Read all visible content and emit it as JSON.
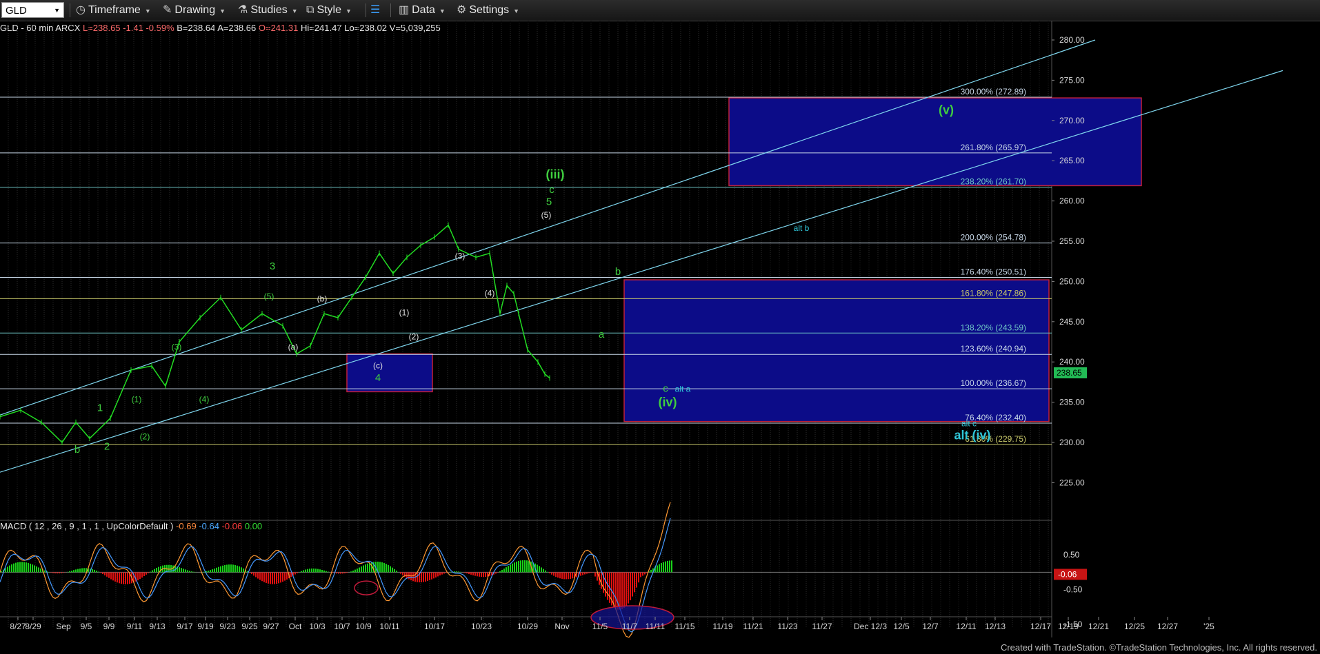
{
  "toolbar": {
    "symbol": "GLD",
    "timeframe": "Timeframe",
    "drawing": "Drawing",
    "studies": "Studies",
    "style": "Style",
    "data": "Data",
    "settings": "Settings"
  },
  "info": {
    "name": "GLD - 60 min  ARCX",
    "last": "L=238.65",
    "change": "-1.41",
    "pct": "-0.59%",
    "bid": "B=238.64",
    "ask": "A=238.66",
    "open": "O=241.31",
    "hi": "Hi=241.47",
    "lo": "Lo=238.02",
    "vol": "V=5,039,255"
  },
  "macd_header": {
    "label": "MACD ( 12 , 26 , 9 , 1 , 1 , UpColorDefault )",
    "v1": "-0.69",
    "v2": "-0.64",
    "v3": "-0.06",
    "v4": "0.00"
  },
  "footer": "Created with TradeStation. ©TradeStation Technologies, Inc. All rights reserved.",
  "colors": {
    "price": "#22dd22",
    "channel": "#7fd6ee",
    "box_fill": "#0c0c88",
    "box_border": "#c0203a",
    "wave_green": "#3fcf3f",
    "wave_white": "#e0e0e0",
    "wave_cyan": "#2fc6d8"
  },
  "chart_data": {
    "type": "line",
    "ylim": [
      220,
      282
    ],
    "y_ticks": [
      225,
      230,
      235,
      240,
      245,
      250,
      255,
      260,
      265,
      270,
      275,
      280
    ],
    "last_price": "238.65",
    "x_ticks": [
      "8/27",
      "8/29",
      "Sep",
      "9/5",
      "9/9",
      "9/11",
      "9/13",
      "9/17",
      "9/19",
      "9/23",
      "9/25",
      "9/27",
      "Oct",
      "10/3",
      "10/7",
      "10/9",
      "10/11",
      "10/17",
      "10/23",
      "10/29",
      "Nov",
      "11/5",
      "11/7",
      "11/11",
      "11/15",
      "11/19",
      "11/21",
      "11/23",
      "11/27",
      "Dec 12/3",
      "12/5",
      "12/7",
      "12/11",
      "12/13",
      "12/17",
      "12/19",
      "12/21",
      "12/25",
      "12/27",
      "'25"
    ],
    "price_path": [
      [
        0,
        233.2
      ],
      [
        30,
        234.0
      ],
      [
        60,
        232.5
      ],
      [
        90,
        230.0
      ],
      [
        110,
        232.5
      ],
      [
        130,
        230.5
      ],
      [
        160,
        233.0
      ],
      [
        190,
        239.0
      ],
      [
        220,
        239.5
      ],
      [
        240,
        237.0
      ],
      [
        260,
        242.5
      ],
      [
        290,
        245.5
      ],
      [
        320,
        248.0
      ],
      [
        350,
        244.0
      ],
      [
        380,
        246.0
      ],
      [
        410,
        244.5
      ],
      [
        430,
        241.0
      ],
      [
        450,
        242.0
      ],
      [
        470,
        246.0
      ],
      [
        490,
        245.5
      ],
      [
        510,
        248.0
      ],
      [
        530,
        250.5
      ],
      [
        550,
        253.5
      ],
      [
        570,
        251.0
      ],
      [
        590,
        253.0
      ],
      [
        610,
        254.5
      ],
      [
        630,
        255.5
      ],
      [
        650,
        257.0
      ],
      [
        665,
        254.0
      ],
      [
        690,
        253.0
      ],
      [
        710,
        253.5
      ],
      [
        725,
        246.0
      ],
      [
        735,
        249.5
      ],
      [
        745,
        248.5
      ],
      [
        752,
        246.0
      ],
      [
        765,
        241.5
      ],
      [
        780,
        240.0
      ],
      [
        790,
        238.5
      ],
      [
        797,
        238.0
      ]
    ],
    "fib_levels": [
      {
        "label": "300.00% (272.89)",
        "value": 272.89
      },
      {
        "label": "261.80% (265.97)",
        "value": 265.97
      },
      {
        "label": "238.20% (261.70)",
        "value": 261.7
      },
      {
        "label": "200.00% (254.78)",
        "value": 254.78
      },
      {
        "label": "176.40% (250.51)",
        "value": 250.51
      },
      {
        "label": "161.80% (247.86)",
        "value": 247.86
      },
      {
        "label": "138.20% (243.59)",
        "value": 243.59
      },
      {
        "label": "123.60% (240.94)",
        "value": 240.94
      },
      {
        "label": "100.00% (236.67)",
        "value": 236.67
      },
      {
        "label": "76.40% (232.40)",
        "value": 232.4
      },
      {
        "label": "61.80% (229.75)",
        "value": 229.75
      }
    ],
    "wave_labels": [
      {
        "text": "b",
        "x": 112,
        "y": 228.7,
        "color": "green"
      },
      {
        "text": "1",
        "x": 145,
        "y": 233.9,
        "color": "green"
      },
      {
        "text": "2",
        "x": 155,
        "y": 229.1,
        "color": "green"
      },
      {
        "text": "(1)",
        "x": 198,
        "y": 235.0,
        "color": "green"
      },
      {
        "text": "(2)",
        "x": 210,
        "y": 230.4,
        "color": "green"
      },
      {
        "text": "(3)",
        "x": 256,
        "y": 241.5,
        "color": "green"
      },
      {
        "text": "(4)",
        "x": 296,
        "y": 235.0,
        "color": "green"
      },
      {
        "text": "3",
        "x": 395,
        "y": 251.5,
        "color": "green"
      },
      {
        "text": "(5)",
        "x": 390,
        "y": 247.8,
        "color": "green"
      },
      {
        "text": "(b)",
        "x": 467,
        "y": 247.5,
        "color": "white"
      },
      {
        "text": "(a)",
        "x": 425,
        "y": 241.5,
        "color": "white"
      },
      {
        "text": "(c)",
        "x": 548,
        "y": 239.2,
        "color": "white"
      },
      {
        "text": "4",
        "x": 548,
        "y": 237.6,
        "color": "green"
      },
      {
        "text": "(1)",
        "x": 586,
        "y": 245.8,
        "color": "white"
      },
      {
        "text": "(2)",
        "x": 600,
        "y": 242.8,
        "color": "white"
      },
      {
        "text": "(3)",
        "x": 667,
        "y": 252.8,
        "color": "white"
      },
      {
        "text": "(4)",
        "x": 710,
        "y": 248.2,
        "color": "white"
      },
      {
        "text": "(5)",
        "x": 792,
        "y": 257.9,
        "color": "white"
      },
      {
        "text": "5",
        "x": 796,
        "y": 259.5,
        "color": "green"
      },
      {
        "text": "c",
        "x": 800,
        "y": 261.0,
        "color": "green"
      },
      {
        "text": "(iii)",
        "x": 805,
        "y": 262.8,
        "color": "green"
      },
      {
        "text": "a",
        "x": 872,
        "y": 243.0,
        "color": "green"
      },
      {
        "text": "b",
        "x": 896,
        "y": 250.8,
        "color": "green"
      },
      {
        "text": "c",
        "x": 965,
        "y": 236.3,
        "color": "green"
      },
      {
        "text": "alt a",
        "x": 990,
        "y": 236.3,
        "color": "cyan"
      },
      {
        "text": "(iv)",
        "x": 968,
        "y": 234.5,
        "color": "green"
      },
      {
        "text": "(v)",
        "x": 1372,
        "y": 270.8,
        "color": "green"
      },
      {
        "text": "alt b",
        "x": 1162,
        "y": 256.3,
        "color": "cyan"
      },
      {
        "text": "alt c",
        "x": 1405,
        "y": 232.0,
        "color": "cyan"
      },
      {
        "text": "alt (iv)",
        "x": 1410,
        "y": 230.4,
        "color": "cyan"
      }
    ],
    "boxes": [
      {
        "x1": 503,
        "x2": 627,
        "y1": 236.3,
        "y2": 241.0
      },
      {
        "x1": 905,
        "x2": 1521,
        "y1": 232.6,
        "y2": 250.2
      },
      {
        "x1": 1057,
        "x2": 1655,
        "y1": 261.9,
        "y2": 272.8
      }
    ],
    "macd": {
      "ylim": [
        -2.0,
        1.2
      ],
      "ticks": [
        0.5,
        -0.5,
        -1.5
      ],
      "current": "-0.06"
    }
  }
}
